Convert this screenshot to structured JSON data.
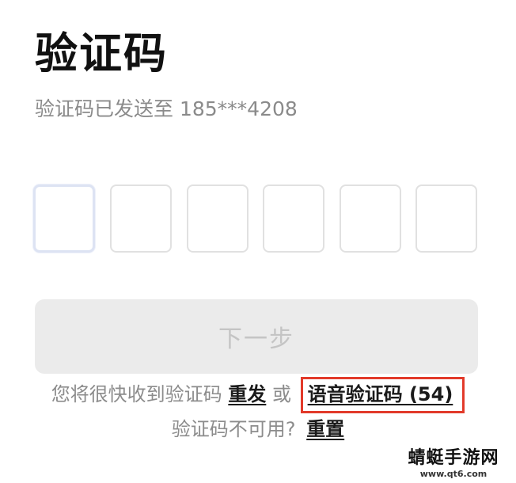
{
  "header": {
    "title": "验证码",
    "subtitle": "验证码已发送至 185***4208"
  },
  "code_input": {
    "box_count": 6,
    "active_index": 0,
    "values": [
      "",
      "",
      "",
      "",
      "",
      ""
    ]
  },
  "next_button": {
    "label": "下一步"
  },
  "hint": {
    "prefix": "您将很快收到验证码",
    "resend_label": "重发",
    "or_text": "或",
    "voice_label": "语音验证码 (54)"
  },
  "reset": {
    "prefix": "验证码不可用?",
    "reset_label": "重置"
  },
  "watermark": {
    "title": "蜻蜓手游网",
    "url": "www.qt6.com"
  },
  "colors": {
    "highlight_border": "#e23a2a",
    "button_bg": "#ebebeb",
    "muted_text": "#8c8c8c"
  }
}
